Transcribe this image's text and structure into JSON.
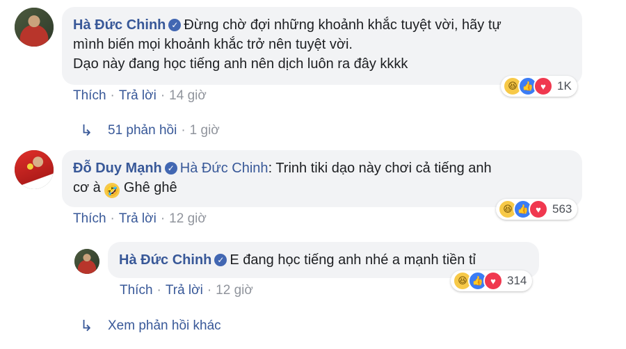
{
  "comments": [
    {
      "author": "Hà Đức Chinh",
      "text_line1": "Đừng chờ đợi những khoảnh khắc tuyệt vời, hãy tự",
      "text_line2": "mình biến mọi khoảnh khắc trở nên tuyệt vời.",
      "text_line3": "Dạo này đang học tiếng anh nên dịch luôn ra đây kkkk",
      "like": "Thích",
      "reply": "Trả lời",
      "time": "14 giờ",
      "reaction_count": "1K",
      "replies_label": "51 phản hồi",
      "replies_time": "1 giờ"
    },
    {
      "author": "Đỗ Duy Mạnh",
      "mention": "Hà Đức Chinh",
      "text_line1": ": Trinh tiki dạo này chơi cả tiếng anh",
      "text_line2_a": "cơ à",
      "text_line2_b": "Ghê ghê",
      "like": "Thích",
      "reply": "Trả lời",
      "time": "12 giờ",
      "reaction_count": "563"
    },
    {
      "author": "Hà Đức Chinh",
      "text": "E đang học tiếng anh nhé a mạnh tiền tỉ",
      "like": "Thích",
      "reply": "Trả lời",
      "time": "12 giờ",
      "reaction_count": "314"
    }
  ],
  "more_replies": "Xem phản hồi khác",
  "separator": "·",
  "icons": {
    "verified": "verified-badge-icon",
    "haha": "haha-reaction-icon",
    "like": "like-reaction-icon",
    "love": "love-reaction-icon",
    "reply_arrow": "reply-arrow-icon"
  },
  "colors": {
    "link": "#385898",
    "bubble": "#f2f3f5",
    "meta": "#90949c"
  }
}
